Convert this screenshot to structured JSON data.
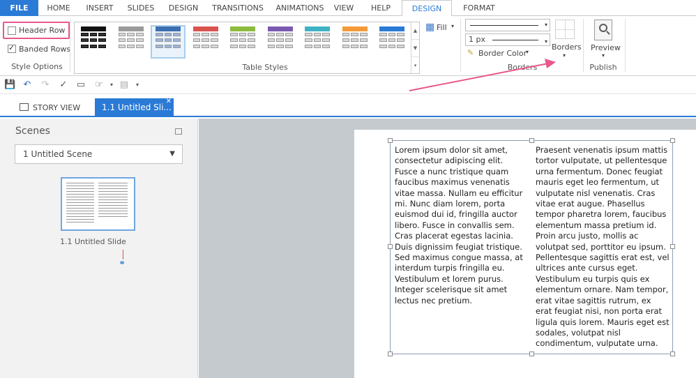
{
  "ribbon_tabs": {
    "file": "FILE",
    "home": "HOME",
    "insert": "INSERT",
    "slides": "SLIDES",
    "design": "DESIGN",
    "transitions": "TRANSITIONS",
    "animations": "ANIMATIONS",
    "view": "VIEW",
    "help": "HELP",
    "ctx_design": "DESIGN",
    "ctx_format": "FORMAT"
  },
  "style_options": {
    "header_row": "Header Row",
    "banded_rows": "Banded Rows",
    "group_label": "Style Options",
    "header_row_checked": false,
    "banded_rows_checked": true
  },
  "table_styles": {
    "group_label": "Table Styles",
    "swatches": [
      "#111111",
      "#9a9a9a",
      "#3e6fb0",
      "#d9534f",
      "#8dbb3e",
      "#7a5ab0",
      "#3fb2c4",
      "#f39a38",
      "#2a7ad6"
    ],
    "selected_index": 2,
    "fill_label": "Fill"
  },
  "borders": {
    "width_value": "1 px",
    "border_color_label": "Border Color",
    "borders_label": "Borders",
    "group_label": "Borders"
  },
  "publish": {
    "preview_label": "Preview",
    "group_label": "Publish"
  },
  "doc_tabs": {
    "story_view": "STORY VIEW",
    "active": "1.1 Untitled Sli..."
  },
  "scenes": {
    "title": "Scenes",
    "selected": "1 Untitled Scene",
    "slide_caption": "1.1 Untitled Slide"
  },
  "table": {
    "col1": "Lorem ipsum dolor sit amet, consectetur adipiscing elit. Fusce a nunc tristique quam faucibus maximus venenatis vitae massa. Nullam eu efficitur mi. Nunc diam lorem, porta euismod dui id, fringilla auctor libero. Fusce in convallis sem. Cras placerat egestas lacinia. Duis dignissim feugiat tristique. Sed maximus congue massa, at interdum turpis fringilla eu. Vestibulum et lorem purus. Integer scelerisque sit amet lectus nec pretium.",
    "col2": "Praesent venenatis ipsum mattis tortor vulputate, ut pellentesque urna fermentum. Donec feugiat mauris eget leo fermentum, ut vulputate nisl venenatis. Cras vitae erat augue. Phasellus tempor pharetra lorem, faucibus elementum massa pretium id. Proin arcu justo, mollis ac volutpat sed, porttitor eu ipsum. Pellentesque sagittis erat est, vel ultrices ante cursus eget. Vestibulum eu turpis quis ex elementum ornare. Nam tempor, erat vitae sagittis rutrum, ex erat feugiat nisi, non porta erat ligula quis lorem. Mauris eget est sodales, volutpat nisl condimentum, vulputate urna."
  },
  "colors": {
    "accent": "#2a7ad6",
    "highlight": "#e9578c"
  }
}
